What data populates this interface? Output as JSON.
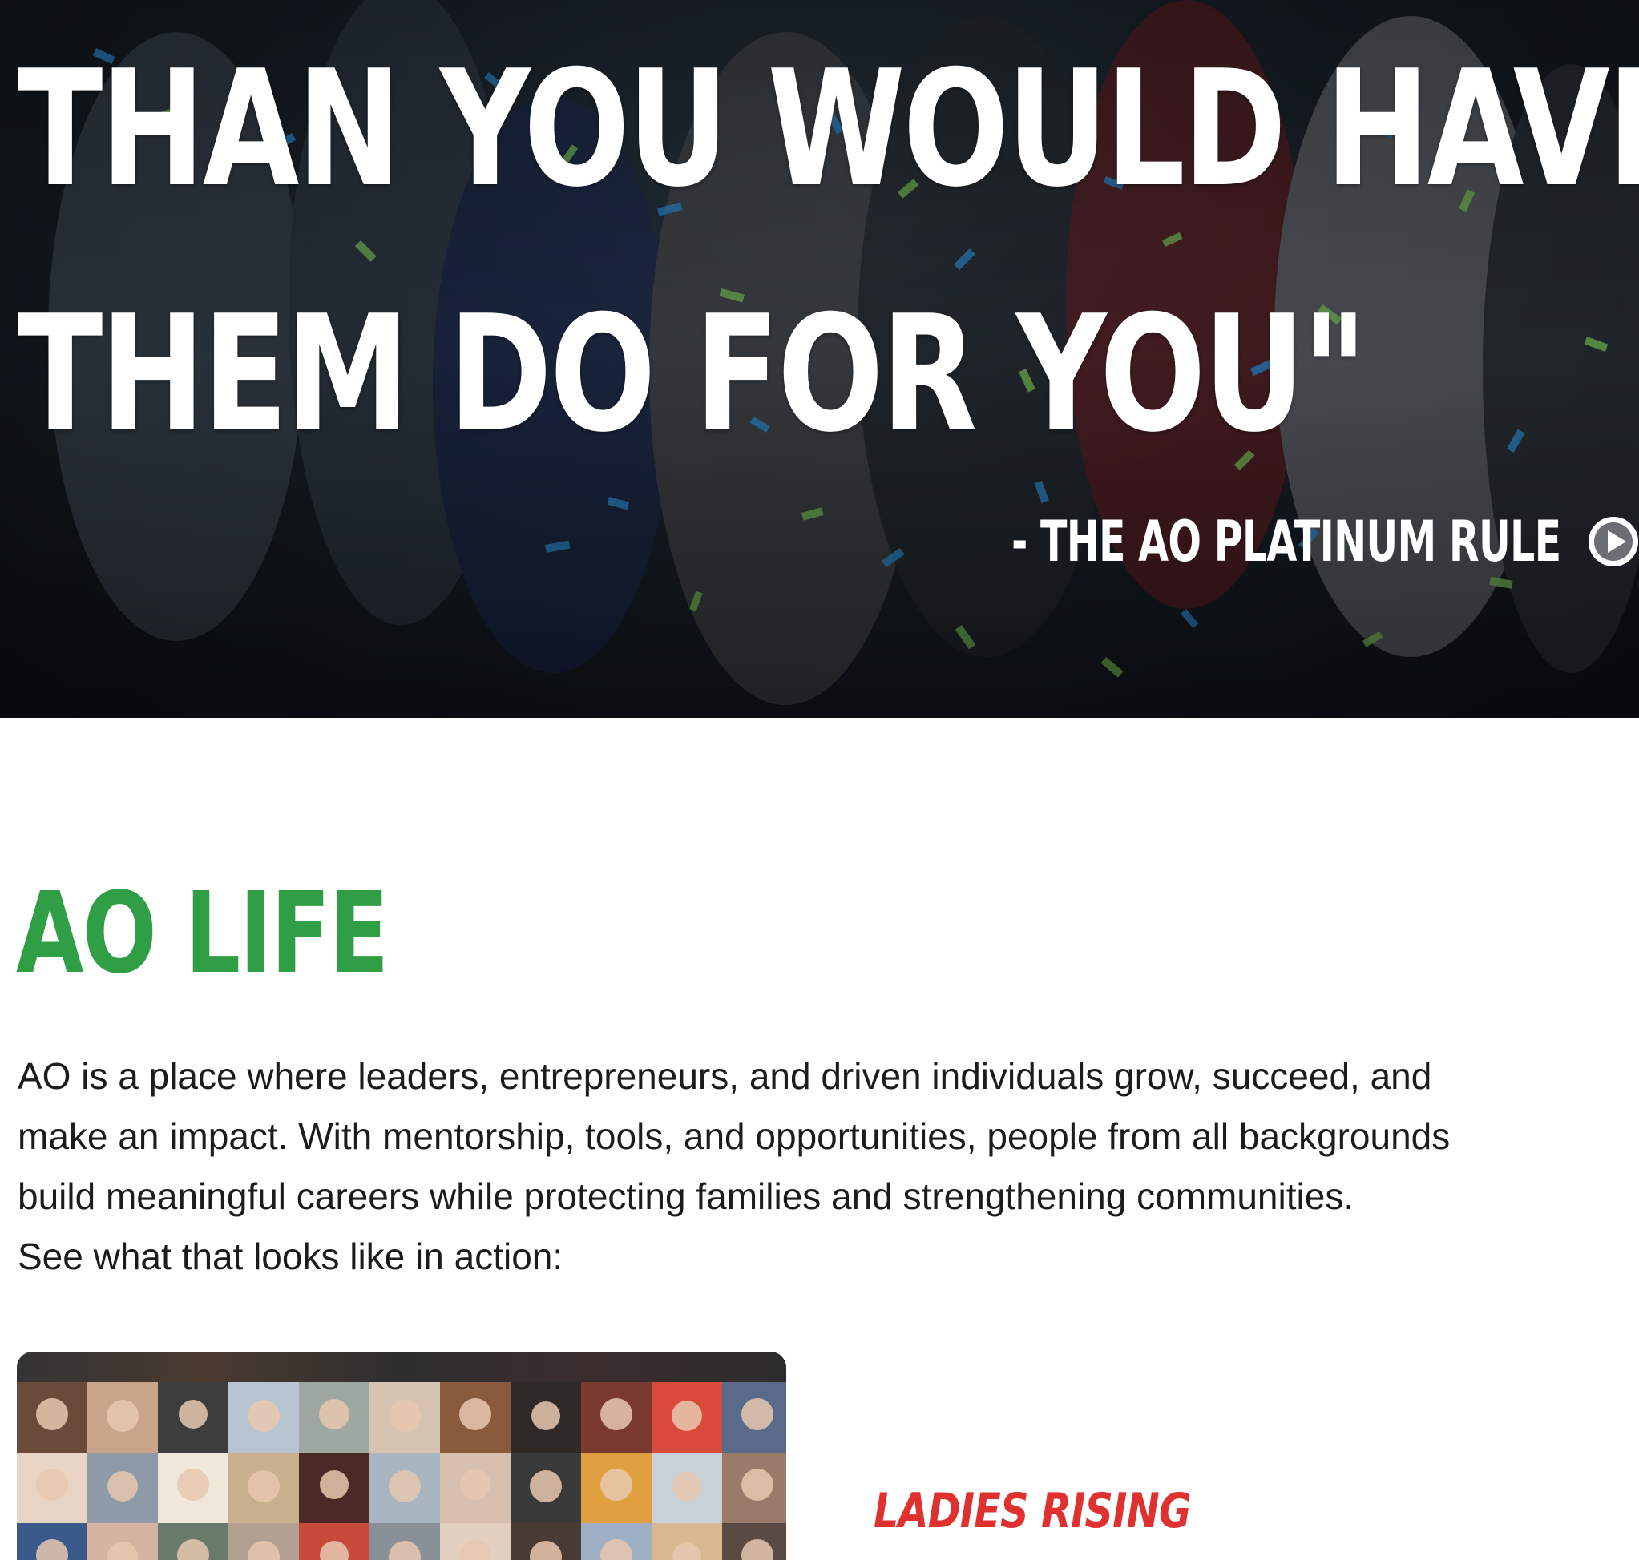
{
  "hero": {
    "quote_line_1": "THAN YOU WOULD HAVE",
    "quote_line_2": "THEM DO FOR YOU\"",
    "attribution": "- THE AO PLATINUM RULE",
    "play_icon": "play-circle-icon"
  },
  "ao_life": {
    "title": "AO LIFE",
    "paragraph_lines": [
      "AO is a place where leaders, entrepreneurs, and driven individuals grow, succeed, and",
      "make an impact. With mentorship, tools, and opportunities, people from all backgrounds",
      "build meaningful careers while protecting families and strengthening communities.",
      "See what that looks like in action:"
    ]
  },
  "feature": {
    "title": "LADIES RISING"
  },
  "colors": {
    "accent_green": "#2f9e44",
    "accent_red": "#e03131",
    "hero_text": "#ffffff",
    "body_text": "#1c1c1c"
  }
}
